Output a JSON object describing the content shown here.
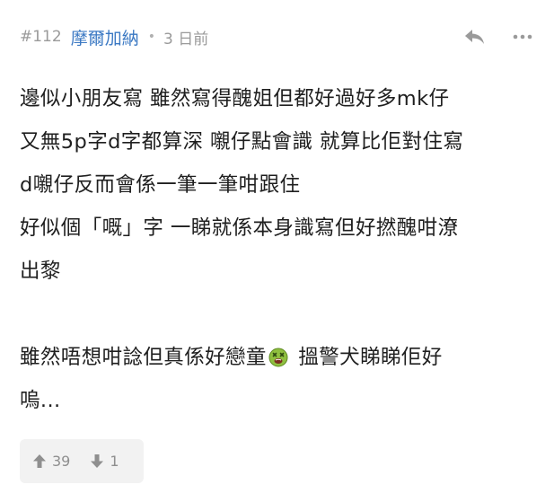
{
  "post": {
    "floor": "#112",
    "author": "摩爾加納",
    "separator": "•",
    "time": "3 日前"
  },
  "icons": {
    "reply": "reply-icon",
    "more": "more-icon",
    "emoji": "sick-face-emoji",
    "upvote": "thumb-up-arrow-icon",
    "downvote": "thumb-down-arrow-icon"
  },
  "content": {
    "lines": [
      "邊似小朋友寫 雖然寫得醜姐但都好過好多mk仔",
      "又無5p字d字都算深 嚫仔點會識 就算比佢對住寫",
      "d嚫仔反而會係一筆一筆咁跟住",
      "好似個「嘅」字 一睇就係本身識寫但好撚醜咁潦",
      "出黎"
    ],
    "line6_before": "雖然唔想咁諗但真係好戀童",
    "line6_after": " 搵警犬睇睇佢好",
    "line7": "嗚..."
  },
  "votes": {
    "up": "39",
    "down": "1"
  },
  "colors": {
    "author": "#3a78c3",
    "meta": "#9a9a9a",
    "vote_bg": "#f2f2f2"
  }
}
